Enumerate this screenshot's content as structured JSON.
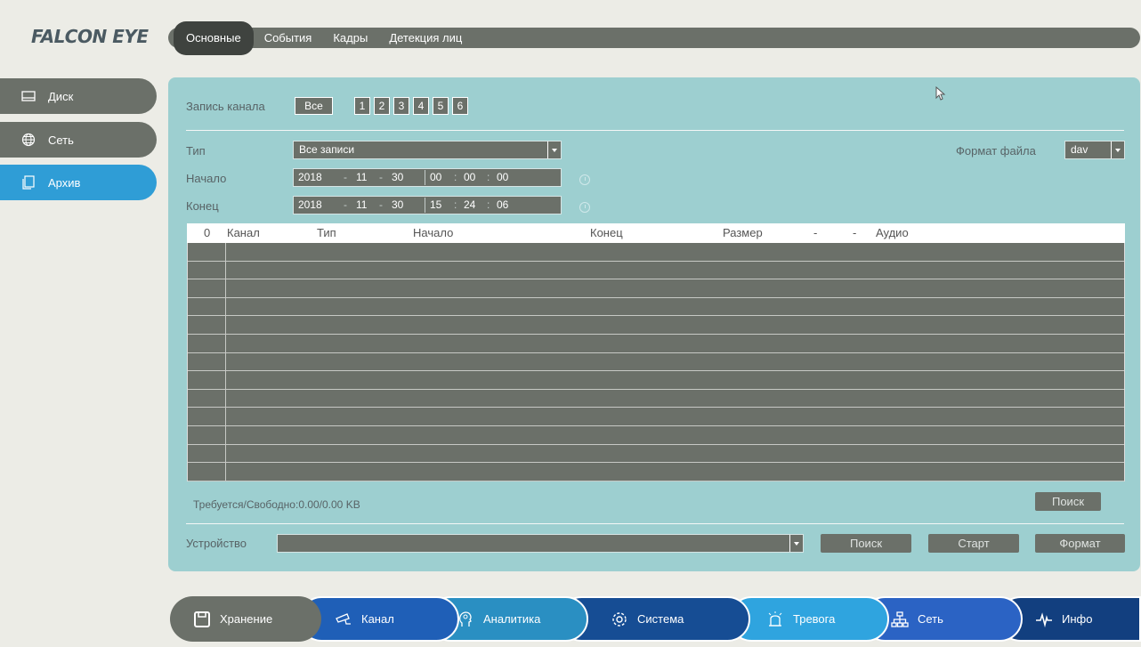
{
  "logo": "FALCON EYE",
  "top_tabs": [
    "Основные",
    "События",
    "Кадры",
    "Детекция лиц"
  ],
  "sidebar": [
    {
      "label": "Диск",
      "icon": "disk-icon"
    },
    {
      "label": "Сеть",
      "icon": "globe-icon"
    },
    {
      "label": "Архив",
      "icon": "archive-icon"
    }
  ],
  "record": {
    "channel_label": "Запись канала",
    "all_label": "Все",
    "channels": [
      "1",
      "2",
      "3",
      "4",
      "5",
      "6"
    ]
  },
  "type": {
    "label": "Тип",
    "value": "Все записи"
  },
  "file_format": {
    "label": "Формат файла",
    "value": "dav"
  },
  "start": {
    "label": "Начало",
    "year": "2018",
    "month": "11",
    "day": "30",
    "hh": "00",
    "mm": "00",
    "ss": "00"
  },
  "end": {
    "label": "Конец",
    "year": "2018",
    "month": "11",
    "day": "30",
    "hh": "15",
    "mm": "24",
    "ss": "06"
  },
  "table": {
    "headers": [
      "0",
      "Канал",
      "Тип",
      "Начало",
      "Конец",
      "Размер",
      "-",
      "-",
      "Аудио"
    ],
    "row_count": 13
  },
  "storage_text": "Требуется/Свободно:0.00/0.00 KB",
  "search_label": "Поиск",
  "device": {
    "label": "Устройство",
    "value": ""
  },
  "buttons": {
    "search": "Поиск",
    "start": "Старт",
    "format": "Формат"
  },
  "bottom_nav": [
    {
      "label": "Хранение",
      "icon": "save-icon"
    },
    {
      "label": "Канал",
      "icon": "camera-icon"
    },
    {
      "label": "Аналитика",
      "icon": "head-icon"
    },
    {
      "label": "Система",
      "icon": "gear-icon"
    },
    {
      "label": "Тревога",
      "icon": "alarm-icon"
    },
    {
      "label": "Сеть",
      "icon": "network-icon"
    },
    {
      "label": "Инфо",
      "icon": "pulse-icon"
    }
  ]
}
